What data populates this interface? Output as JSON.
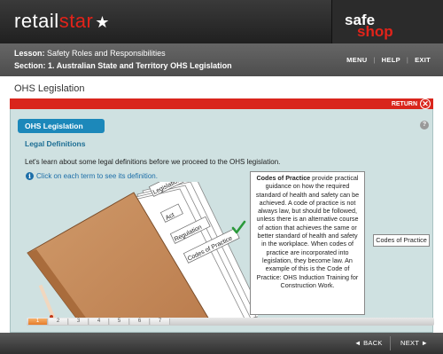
{
  "brand": {
    "part1": "retail",
    "part2": "star",
    "star_glyph": "★",
    "shopsafe_part1": "shop",
    "shopsafe_part2": "safe",
    "accent_color": "#e2231a"
  },
  "lesson": {
    "lesson_label": "Lesson:",
    "lesson_value": "Safety Roles and Responsibilities",
    "section_label": "Section:",
    "section_value": "1. Australian State and Territory OHS Legislation"
  },
  "topnav": {
    "menu": "MENU",
    "help": "HELP",
    "exit": "EXIT"
  },
  "page_title": "OHS Legislation",
  "return_label": "RETURN",
  "return_icon": "close-circle-icon",
  "content": {
    "tag": "OHS Legislation",
    "help_glyph": "?",
    "heading": "Legal Definitions",
    "intro": "Let's learn about some legal definitions before we proceed to the OHS legislation.",
    "hint_icon": "i",
    "hint": "Click on each term to see its definition."
  },
  "folder_tabs": [
    "Legislation",
    "Act",
    "Regulation",
    "Codes of Practice"
  ],
  "definition": {
    "term": "Codes of Practice",
    "text": " provide practical guidance on how the required standard of health and safety can be achieved. A code of practice is not always law, but should be followed, unless there is an alternative course of action that achieves the same or better standard of health and safety in the workplace. When codes of practice are incorporated into legislation, they become law. An example of this is the Code of Practice: OHS Induction Training for Construction Work."
  },
  "codes_label": "Codes of Practice",
  "progress": {
    "pages": [
      "1",
      "2",
      "3",
      "4",
      "5",
      "6",
      "7"
    ],
    "current": "1"
  },
  "bottomnav": {
    "back": "◄ BACK",
    "next": "NEXT ►"
  }
}
